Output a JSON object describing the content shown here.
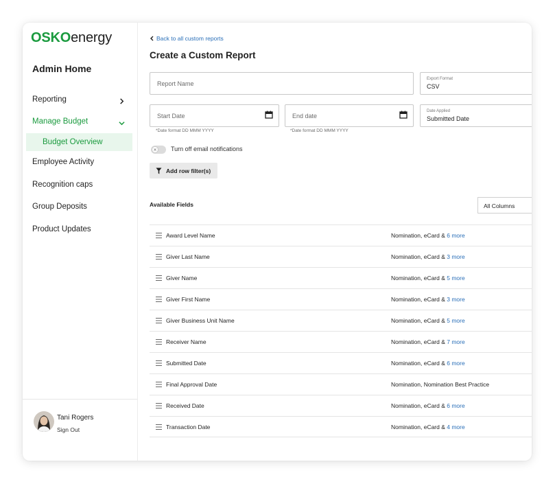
{
  "brand": {
    "name": "OSKO",
    "suffix": "energy",
    "color": "#1a9a3e"
  },
  "sidebar": {
    "title": "Admin Home",
    "items": [
      {
        "label": "Reporting",
        "icon": "chevron-right-icon"
      },
      {
        "label": "Manage Budget",
        "icon": "chevron-down-icon",
        "active": true
      },
      {
        "label": "Employee Activity"
      },
      {
        "label": "Recognition caps"
      },
      {
        "label": "Group Deposits"
      },
      {
        "label": "Product Updates"
      }
    ],
    "sub_item": {
      "label": "Budget Overview"
    },
    "user": {
      "name": "Tani Rogers",
      "action": "Sign Out"
    }
  },
  "main": {
    "back_link": "Back to all custom reports",
    "title": "Create a Custom Report",
    "report_name": {
      "placeholder": "Report Name",
      "value": ""
    },
    "export_format": {
      "label": "Export Format",
      "value": "CSV"
    },
    "start_date": {
      "placeholder": "Start Date",
      "hint": "*Date format DD MMM YYYY"
    },
    "end_date": {
      "placeholder": "End date",
      "hint": "*Date format DD MMM YYYY"
    },
    "date_applied": {
      "label": "Date Applied",
      "value": "Submitted Date"
    },
    "email_toggle": {
      "label": "Turn off email notifications",
      "on": false
    },
    "filter_button": "Add row filter(s)",
    "available_fields": {
      "title": "Available Fields",
      "columns_select": "All Columns",
      "rows": [
        {
          "name": "Award Level Name",
          "programs": "Nomination, eCard & ",
          "more": "6 more"
        },
        {
          "name": "Giver Last Name",
          "programs": "Nomination, eCard & ",
          "more": "3 more"
        },
        {
          "name": "Giver Name",
          "programs": "Nomination, eCard & ",
          "more": "5 more"
        },
        {
          "name": "Giver First Name",
          "programs": "Nomination, eCard & ",
          "more": "3 more"
        },
        {
          "name": "Giver Business Unit Name",
          "programs": "Nomination, eCard & ",
          "more": "5 more"
        },
        {
          "name": "Receiver Name",
          "programs": "Nomination, eCard & ",
          "more": "7 more"
        },
        {
          "name": "Submitted Date",
          "programs": "Nomination, eCard & ",
          "more": "6 more"
        },
        {
          "name": "Final Approval Date",
          "programs": "Nomination, Nomination Best Practice",
          "more": ""
        },
        {
          "name": "Received Date",
          "programs": "Nomination, eCard & ",
          "more": "6 more"
        },
        {
          "name": "Transaction Date",
          "programs": "Nomination, eCard & ",
          "more": "4 more"
        }
      ]
    }
  },
  "colors": {
    "accent": "#1a9a3e",
    "link": "#2a6fb8",
    "active_bg": "#e8f6ec"
  }
}
